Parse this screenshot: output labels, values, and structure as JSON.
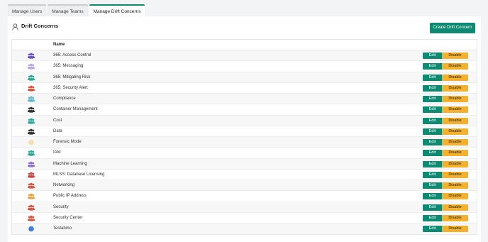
{
  "tabs": [
    {
      "label": "Manage Users",
      "active": false
    },
    {
      "label": "Manage Teams",
      "active": false
    },
    {
      "label": "Manage Drift Concerns",
      "active": true
    }
  ],
  "header": {
    "title": "Drift Concerns",
    "icon": "user-icon",
    "create_button": "Create Drift Concern"
  },
  "table": {
    "columns": [
      "Name"
    ],
    "edit_label": "Edit",
    "disable_label": "Disable",
    "rows": [
      {
        "name": "365: Access Control",
        "icon": "team-icon",
        "color": "#6b4fc9"
      },
      {
        "name": "365: Messaging",
        "icon": "team-icon",
        "color": "#b7a6ea"
      },
      {
        "name": "365: Mitigating Risk",
        "icon": "team-icon",
        "color": "#27a99a"
      },
      {
        "name": "365: Security Alert",
        "icon": "team-icon",
        "color": "#e0503b"
      },
      {
        "name": "Compliance",
        "icon": "team-icon",
        "color": "#5bb8c9"
      },
      {
        "name": "Container Management",
        "icon": "team-icon",
        "color": "#333333"
      },
      {
        "name": "Cost",
        "icon": "team-icon",
        "color": "#27a99a"
      },
      {
        "name": "Data",
        "icon": "team-icon",
        "color": "#333333"
      },
      {
        "name": "Forensic Mode",
        "icon": "circle-icon",
        "color": "#f6dcae"
      },
      {
        "name": "IAM",
        "icon": "team-icon",
        "color": "#27a99a"
      },
      {
        "name": "Machine Learning",
        "icon": "team-icon",
        "color": "#8f6fd8"
      },
      {
        "name": "MLSS: Database Licensing",
        "icon": "team-icon",
        "color": "#d23b3b"
      },
      {
        "name": "Networking",
        "icon": "team-icon",
        "color": "#e0503b"
      },
      {
        "name": "Public IP Address",
        "icon": "team-icon",
        "color": "#f0a23a"
      },
      {
        "name": "Security",
        "icon": "team-icon",
        "color": "#e0503b"
      },
      {
        "name": "Security Center",
        "icon": "team-icon",
        "color": "#e0503b"
      },
      {
        "name": "Testabmo",
        "icon": "circle-icon",
        "color": "#3f7fe0"
      }
    ]
  },
  "colors": {
    "accent": "#0e8a72",
    "warning": "#f5b12b"
  }
}
